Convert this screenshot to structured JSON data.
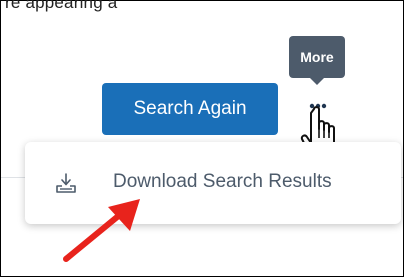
{
  "top_partial_text": "re appearing a",
  "search_again_label": "Search Again",
  "more_tooltip": "More",
  "more_button_icon": "more-horizontal-icon",
  "menu": {
    "items": [
      {
        "label": "Download Search Results",
        "icon": "download-icon"
      }
    ]
  },
  "colors": {
    "primary_button": "#1a6fb8",
    "tooltip_bg": "#4d5b6b",
    "menu_text": "#4d5b6b",
    "annotation_arrow": "#e8231c"
  }
}
